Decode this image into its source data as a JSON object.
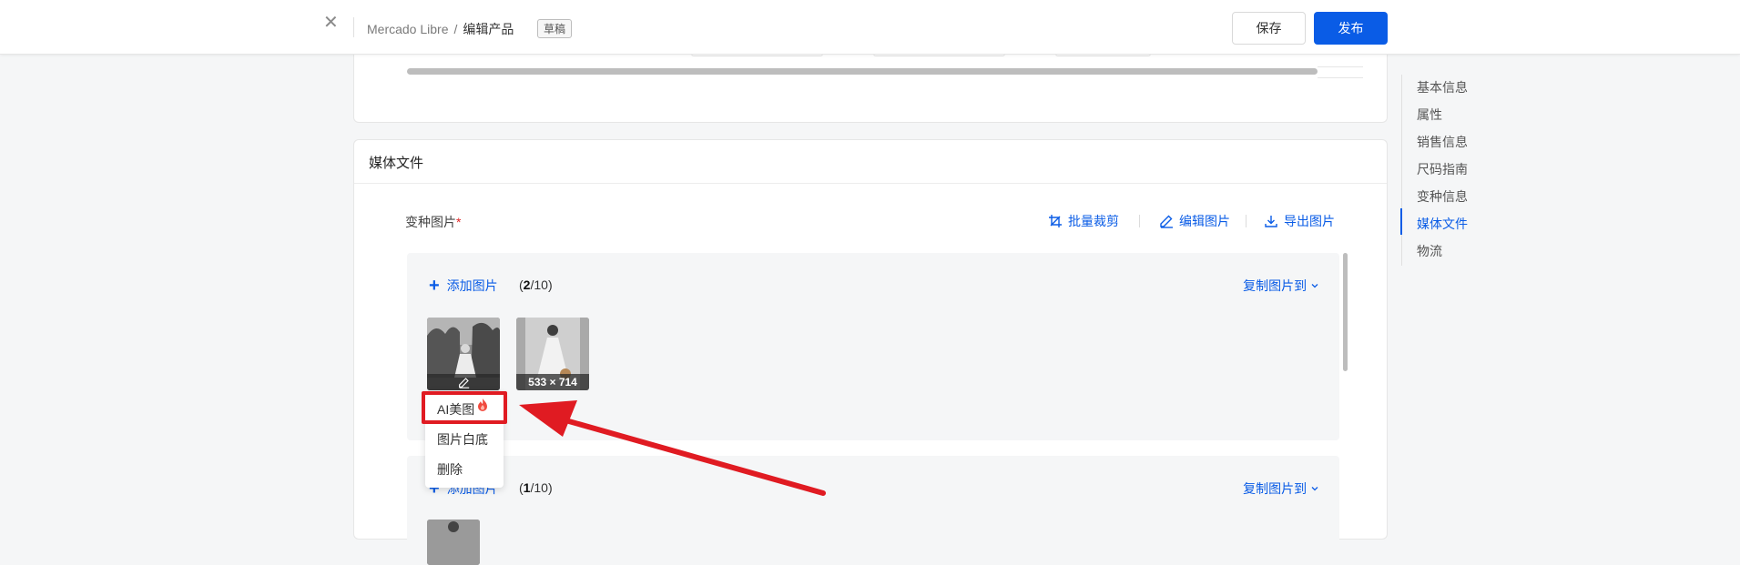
{
  "header": {
    "breadcrumb_store": "Mercado Libre",
    "breadcrumb_sep": "/",
    "breadcrumb_current": "编辑产品",
    "draft_badge": "草稿",
    "save_label": "保存",
    "publish_label": "发布"
  },
  "media": {
    "section_title": "媒体文件",
    "variant_label": "变种图片",
    "required_mark": "*",
    "tools": {
      "batch_crop": "批量裁剪",
      "edit_image": "编辑图片",
      "export_image": "导出图片"
    },
    "groups": [
      {
        "add_label": "添加图片",
        "count_current": "2",
        "count_total": "/10",
        "copy_to": "复制图片到"
      },
      {
        "add_label": "添加图片",
        "count_current": "1",
        "count_total": "/10",
        "copy_to": "复制图片到"
      }
    ],
    "thumbs": [
      {
        "name": "variant-thumb-1"
      },
      {
        "name": "variant-thumb-2",
        "size_label": "533 × 714"
      }
    ],
    "context_menu": [
      "AI美图",
      "图片白底",
      "删除"
    ]
  },
  "side_nav": {
    "items": [
      "基本信息",
      "属性",
      "销售信息",
      "尺码指南",
      "变种信息",
      "媒体文件",
      "物流"
    ],
    "active": "媒体文件"
  },
  "colors": {
    "accent": "#0a5ce6",
    "annotation": "#e01b22"
  }
}
